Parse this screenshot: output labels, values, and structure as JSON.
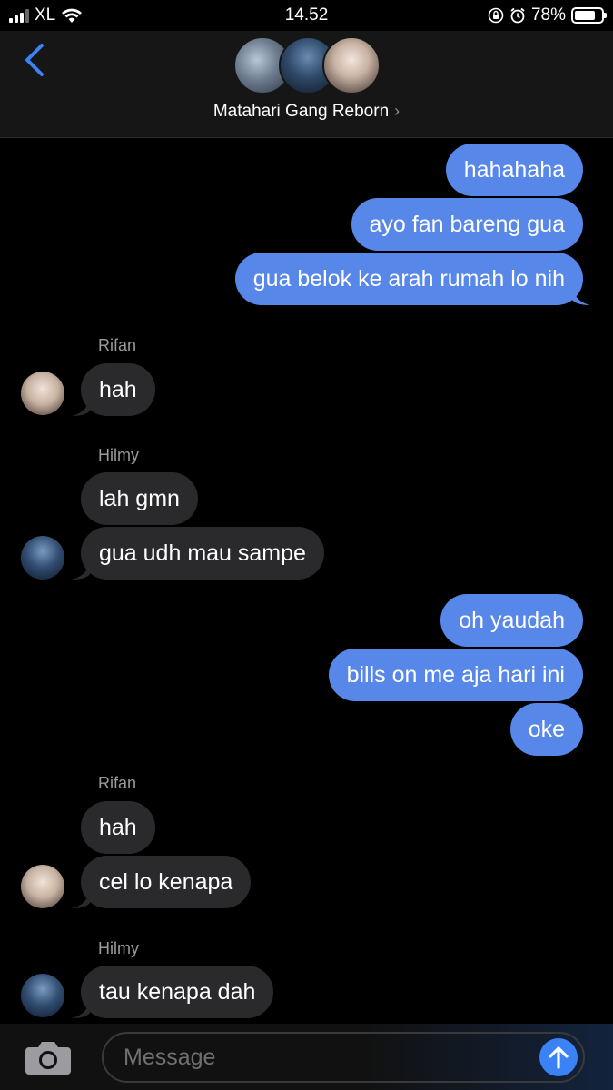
{
  "status_bar": {
    "carrier": "XL",
    "time": "14.52",
    "battery_percent": "78%",
    "battery_level": 0.78
  },
  "header": {
    "group_name": "Matahari Gang Reborn",
    "back_icon": "chevron-left-icon",
    "chevron": "›"
  },
  "messages": [
    {
      "direction": "outgoing",
      "text": "hahahaha"
    },
    {
      "direction": "outgoing",
      "text": "ayo fan bareng gua"
    },
    {
      "direction": "outgoing",
      "text": "gua belok ke arah rumah lo nih"
    },
    {
      "direction": "incoming",
      "sender": "Rifan",
      "text": "hah"
    },
    {
      "direction": "incoming",
      "sender": "Hilmy",
      "text": "lah gmn"
    },
    {
      "direction": "incoming",
      "text": "gua udh mau sampe"
    },
    {
      "direction": "outgoing",
      "text": "oh yaudah"
    },
    {
      "direction": "outgoing",
      "text": "bills on me aja hari ini"
    },
    {
      "direction": "outgoing",
      "text": "oke"
    },
    {
      "direction": "incoming",
      "sender": "Rifan",
      "text": "hah"
    },
    {
      "direction": "incoming",
      "text": "cel lo kenapa"
    },
    {
      "direction": "incoming",
      "sender": "Hilmy",
      "text": "tau kenapa dah"
    }
  ],
  "input": {
    "placeholder": "Message",
    "camera_icon": "camera-icon",
    "send_icon": "arrow-up-icon"
  },
  "colors": {
    "outgoing_bubble": "#5887ea",
    "incoming_bubble": "#2a2a2d",
    "accent": "#3b82f6",
    "background": "#000000"
  }
}
